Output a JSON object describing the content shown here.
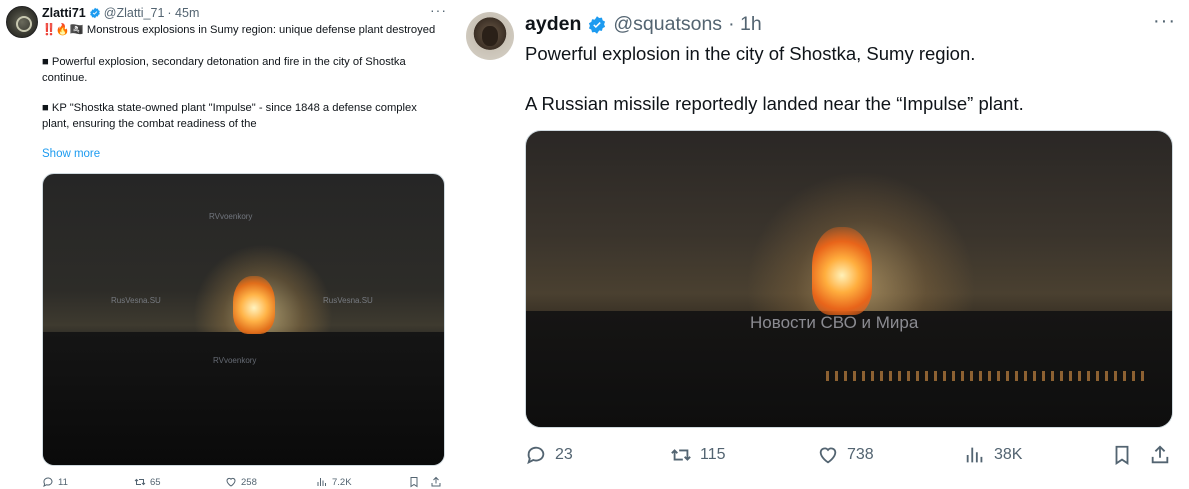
{
  "left_tweet": {
    "author_name": "Zlatti71",
    "handle": "@Zlatti_71",
    "time": "· 45m",
    "more": "···",
    "text_line1": "Monstrous explosions in Sumy region: unique defense plant destroyed",
    "emoji_prefix": "‼️🔥🏴‍☠️",
    "text_p2": "■  Powerful explosion, secondary detonation and fire in the city of Shostka continue.",
    "text_p3": "■  KP \"Shostka state-owned plant \"Impulse\" - since 1848 a defense complex plant, ensuring the combat readiness of the",
    "show_more": "Show more",
    "watermarks": [
      "RVvoenkory",
      "RusVesna.SU",
      "RusVesna.SU",
      "RVvoenkory"
    ],
    "actions": {
      "replies": "11",
      "reposts": "65",
      "likes": "258",
      "views": "7.2K"
    }
  },
  "right_tweet": {
    "author_name": "ayden",
    "handle": "@squatsons",
    "time": "· 1h",
    "more": "···",
    "text_p1": "Powerful explosion in the city of Shostka, Sumy region.",
    "text_p2": "A Russian missile reportedly landed near the “Impulse” plant.",
    "watermark": "Новости СВО и Мира",
    "actions": {
      "replies": "23",
      "reposts": "115",
      "likes": "738",
      "views": "38K"
    }
  },
  "colors": {
    "verified": "#1d9bf0",
    "link": "#1d9bf0",
    "secondary_text": "#536471"
  }
}
